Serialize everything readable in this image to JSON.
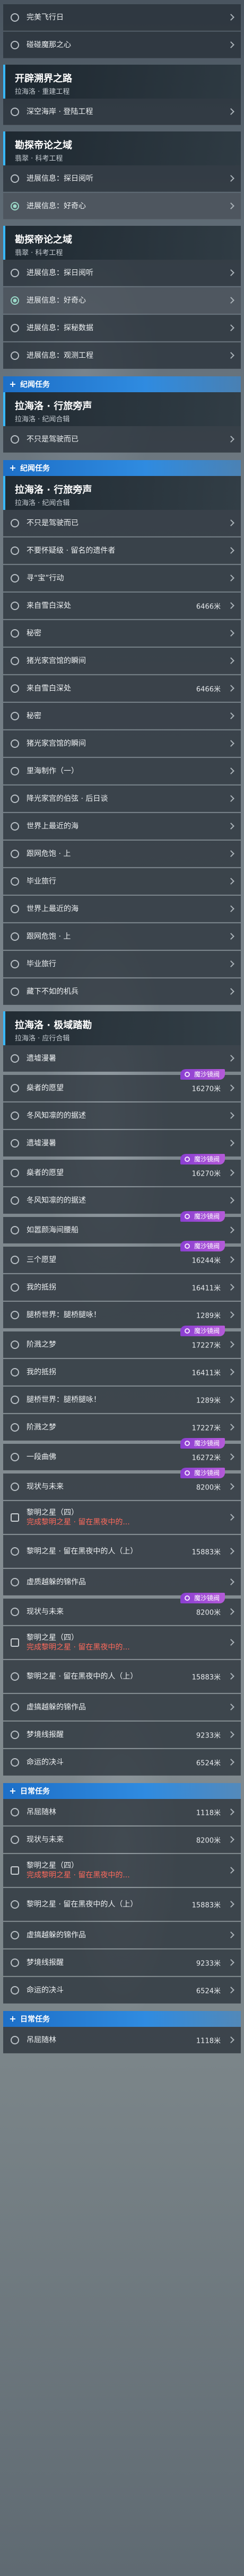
{
  "colors": {
    "accent": "#2f8be0",
    "chapter_bar": "#38b8ff",
    "tag": "#b45ad8",
    "red_text": "#ff6a5c",
    "row_bg": "#262e36"
  },
  "rows": [
    {
      "type": "quest",
      "name": "完美飞行日",
      "icon": "circle"
    },
    {
      "type": "quest",
      "name": "碰碰魔那之心",
      "icon": "circle"
    },
    {
      "type": "chapter",
      "title": "开辟溯界之路",
      "subtitle": "拉海洛 · 重建工程"
    },
    {
      "type": "quest",
      "name": "深空海岸 · 登陆工程",
      "icon": "circle"
    },
    {
      "type": "chapter",
      "title": "勘探帝论之域",
      "subtitle": "翡翠 · 科考工程"
    },
    {
      "type": "quest",
      "name": "进展信息：探日阅听",
      "icon": "circle"
    },
    {
      "type": "quest",
      "name": "进展信息：好奇心",
      "icon": "done",
      "active": true
    },
    {
      "type": "chapter",
      "title": "勘探帝论之域",
      "subtitle": "翡翠 · 科考工程"
    },
    {
      "type": "quest",
      "name": "进展信息：探日阅听",
      "icon": "circle"
    },
    {
      "type": "quest",
      "name": "进展信息：好奇心",
      "icon": "done",
      "active": true
    },
    {
      "type": "quest",
      "name": "进展信息：探秘数据",
      "icon": "circle"
    },
    {
      "type": "quest",
      "name": "进展信息：观测工程",
      "icon": "circle"
    },
    {
      "type": "section",
      "title": "纪闻任务"
    },
    {
      "type": "chapter",
      "title": "拉海洛 · 行旅旁声",
      "subtitle": "拉海洛 · 纪闻合辑"
    },
    {
      "type": "quest",
      "name": "不只是驾驶而已",
      "icon": "circle"
    },
    {
      "type": "section",
      "title": "纪闻任务"
    },
    {
      "type": "chapter",
      "title": "拉海洛 · 行旅旁声",
      "subtitle": "拉海洛 · 纪闻合辑"
    },
    {
      "type": "quest",
      "name": "不只是驾驶而已",
      "icon": "circle"
    },
    {
      "type": "quest",
      "name": "不要怀疑级 · 留名的遗件者",
      "icon": "circle"
    },
    {
      "type": "quest",
      "name": "寻“宝”行动",
      "icon": "circle"
    },
    {
      "type": "quest",
      "name": "来自雪白深处",
      "icon": "circle",
      "value": "6466米"
    },
    {
      "type": "quest",
      "name": "秘密",
      "icon": "circle"
    },
    {
      "type": "quest",
      "name": "猪光家宫馆的瞬间",
      "icon": "circle"
    },
    {
      "type": "quest",
      "name": "来自雪白深处",
      "icon": "circle",
      "value": "6466米"
    },
    {
      "type": "quest",
      "name": "秘密",
      "icon": "circle"
    },
    {
      "type": "quest",
      "name": "猪光家宫馆的瞬间",
      "icon": "circle"
    },
    {
      "type": "quest",
      "name": "里海制作（一）",
      "icon": "circle"
    },
    {
      "type": "quest",
      "name": "降光家宫的伯弦 · 后日谈",
      "icon": "circle"
    },
    {
      "type": "quest",
      "name": "世界上最近的海",
      "icon": "circle"
    },
    {
      "type": "quest",
      "name": "跟网危饱 · 上",
      "icon": "circle"
    },
    {
      "type": "quest",
      "name": "毕业旅行",
      "icon": "circle"
    },
    {
      "type": "quest",
      "name": "世界上最近的海",
      "icon": "circle"
    },
    {
      "type": "quest",
      "name": "跟网危饱 · 上",
      "icon": "circle"
    },
    {
      "type": "quest",
      "name": "毕业旅行",
      "icon": "circle"
    },
    {
      "type": "quest",
      "name": "藏下不如的机兵",
      "icon": "circle"
    },
    {
      "type": "chapter",
      "title": "拉海洛 · 极域踏勘",
      "subtitle": "拉海洛 · 应行合辑"
    },
    {
      "type": "quest",
      "name": "遗墟漫暑",
      "icon": "circle"
    },
    {
      "type": "quest",
      "name": "燊者的愿望",
      "icon": "circle",
      "value": "16270米",
      "tag": "魔沙镜阀"
    },
    {
      "type": "quest",
      "name": "冬风知凛的的据述",
      "icon": "circle"
    },
    {
      "type": "quest",
      "name": "遗墟漫暑",
      "icon": "circle"
    },
    {
      "type": "quest",
      "name": "燊者的愿望",
      "icon": "circle",
      "value": "16270米",
      "tag": "魔沙镜阀"
    },
    {
      "type": "quest",
      "name": "冬风知凛的的据述",
      "icon": "circle"
    },
    {
      "type": "quest",
      "name": "如嚣颜海间腰船",
      "icon": "circle",
      "tag": "魔沙镜阀"
    },
    {
      "type": "quest",
      "name": "三个愿望",
      "icon": "circle",
      "value": "16244米",
      "tag": "魔沙镜阀"
    },
    {
      "type": "quest",
      "name": "我的抵拐",
      "icon": "circle",
      "value": "16411米"
    },
    {
      "type": "quest",
      "name": "腿桥世界：腿桥腿咏！",
      "icon": "circle",
      "value": "1289米"
    },
    {
      "type": "quest",
      "name": "阶溅之梦",
      "icon": "circle",
      "value": "17227米",
      "tag": "魔沙镜阀"
    },
    {
      "type": "quest",
      "name": "我的抵拐",
      "icon": "circle",
      "value": "16411米"
    },
    {
      "type": "quest",
      "name": "腿桥世界：腿桥腿咏！",
      "icon": "circle",
      "value": "1289米"
    },
    {
      "type": "quest",
      "name": "阶溅之梦",
      "icon": "circle",
      "value": "17227米"
    },
    {
      "type": "quest",
      "name": "一段曲佛",
      "icon": "circle",
      "value": "16272米",
      "tag": "魔沙镜阀"
    },
    {
      "type": "quest",
      "name": "现状与未来",
      "icon": "circle",
      "value": "8200米",
      "tag": "魔沙镜阀"
    },
    {
      "type": "quest",
      "name": "黎明之星（四）",
      "red": "完成黎明之星 · 留在黑夜中的...",
      "icon": "lock"
    },
    {
      "type": "quest",
      "name": "黎明之星 · 留在黑夜中的人（上）",
      "icon": "circle",
      "value": "15883米"
    },
    {
      "type": "quest",
      "name": "虚质越躲的锦作品",
      "icon": "circle"
    },
    {
      "type": "quest",
      "name": "现状与未来",
      "icon": "circle",
      "value": "8200米",
      "tag": "魔沙镜阀"
    },
    {
      "type": "quest",
      "name": "黎明之星（四）",
      "red": "完成黎明之星 · 留在黑夜中的...",
      "icon": "lock"
    },
    {
      "type": "quest",
      "name": "黎明之星 · 留在黑夜中的人（上）",
      "icon": "circle",
      "value": "15883米"
    },
    {
      "type": "quest",
      "name": "虚搞越躲的锦作品",
      "icon": "circle"
    },
    {
      "type": "quest",
      "name": "梦境线报醒",
      "icon": "circle",
      "value": "9233米"
    },
    {
      "type": "quest",
      "name": "命运的决斗",
      "icon": "circle",
      "value": "6524米"
    },
    {
      "type": "section",
      "title": "日常任务"
    },
    {
      "type": "quest",
      "name": "吊屈随林",
      "icon": "circle",
      "value": "1118米"
    },
    {
      "type": "quest",
      "name": "现状与未来",
      "icon": "circle",
      "value": "8200米"
    },
    {
      "type": "quest",
      "name": "黎明之星（四）",
      "red": "完成黎明之星 · 留在黑夜中的...",
      "icon": "lock"
    },
    {
      "type": "quest",
      "name": "黎明之星 · 留在黑夜中的人（上）",
      "icon": "circle",
      "value": "15883米"
    },
    {
      "type": "quest",
      "name": "虚搞越躲的锦作品",
      "icon": "circle"
    },
    {
      "type": "quest",
      "name": "梦境线报醒",
      "icon": "circle",
      "value": "9233米"
    },
    {
      "type": "quest",
      "name": "命运的决斗",
      "icon": "circle",
      "value": "6524米"
    },
    {
      "type": "section",
      "title": "日常任务"
    },
    {
      "type": "quest",
      "name": "吊屈随林",
      "icon": "circle",
      "value": "1118米"
    }
  ]
}
